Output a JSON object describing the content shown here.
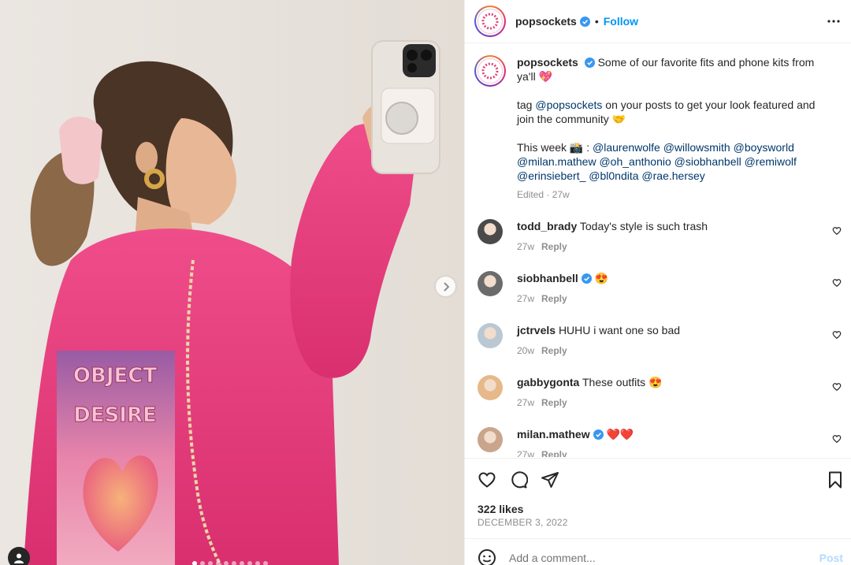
{
  "post": {
    "username": "popsockets",
    "follow_label": "Follow",
    "separator": "•",
    "caption": {
      "text_1": "Some of our favorite fits and phone kits from ya'll 💖",
      "text_2_pre": "tag ",
      "text_2_mention": "@popsockets",
      "text_2_post": " on your posts to get your look featured and join the community 🤝",
      "text_3_pre": "This week 📸 : ",
      "mentions": [
        "@laurenwolfe",
        "@willowsmith",
        "@boysworld",
        "@milan.mathew",
        "@oh_anthonio",
        "@siobhanbell",
        "@remiwolf",
        "@erinsiebert_",
        "@bl0ndita",
        "@rae.hersey"
      ],
      "edited": "Edited",
      "time": "27w"
    },
    "comments": [
      {
        "user": "todd_brady",
        "text": "Today's style is such trash",
        "time": "27w",
        "reply": "Reply",
        "verified": false,
        "avatar_color": "#4a4a4a"
      },
      {
        "user": "siobhanbell",
        "text": "😍",
        "time": "27w",
        "reply": "Reply",
        "verified": true,
        "avatar_color": "#6b6b6b"
      },
      {
        "user": "jctrvels",
        "text": "HUHU i want one so bad",
        "time": "20w",
        "reply": "Reply",
        "verified": false,
        "avatar_color": "#b9c8d3"
      },
      {
        "user": "gabbygonta",
        "text": "These outfits 😍",
        "time": "27w",
        "reply": "Reply",
        "verified": false,
        "avatar_color": "#e6b98a"
      },
      {
        "user": "milan.mathew",
        "text": "❤️❤️",
        "time": "27w",
        "reply": "Reply",
        "verified": true,
        "avatar_color": "#c9a58c"
      }
    ],
    "likes": "322 likes",
    "date": "DECEMBER 3, 2022",
    "add_comment_placeholder": "Add a comment...",
    "post_label": "Post"
  },
  "photo": {
    "shirt_print_text": "OBJECT DESIRE",
    "carousel": {
      "count": 10,
      "active_index": 0
    }
  },
  "colors": {
    "accent": "#0095f6",
    "mention": "#00376b",
    "shirt": "#e83f7e",
    "verified": "#3897f0"
  }
}
